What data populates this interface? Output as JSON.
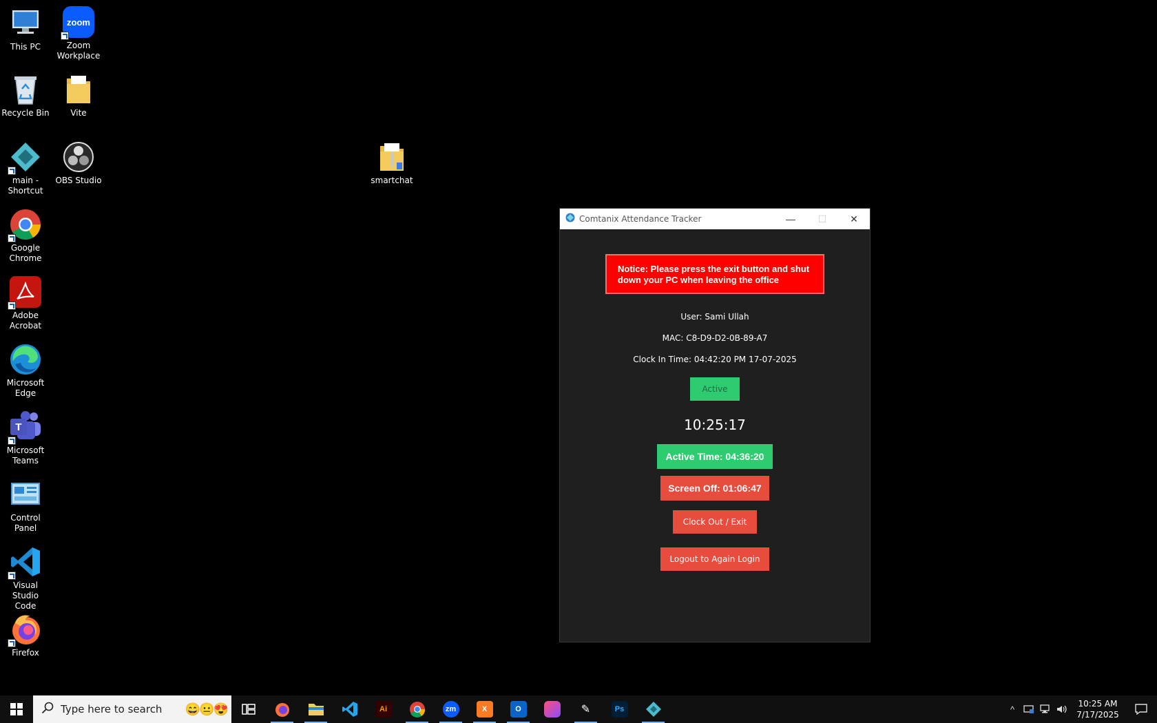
{
  "desktop": {
    "icons": [
      {
        "label": "This PC",
        "icon": "this-pc-icon"
      },
      {
        "label": "Zoom\nWorkplace",
        "icon": "zoom-icon",
        "glyph_text": "zoom"
      },
      {
        "label": "Recycle Bin",
        "icon": "recycle-bin-icon"
      },
      {
        "label": "Vite",
        "icon": "folder-icon"
      },
      {
        "label": "main -\nShortcut",
        "icon": "app-shortcut-icon"
      },
      {
        "label": "OBS Studio",
        "icon": "obs-icon"
      },
      {
        "label": "smartchat",
        "icon": "zip-folder-icon"
      },
      {
        "label": "Google\nChrome",
        "icon": "chrome-icon"
      },
      {
        "label": "Adobe\nAcrobat",
        "icon": "acrobat-icon"
      },
      {
        "label": "Microsoft\nEdge",
        "icon": "edge-icon"
      },
      {
        "label": "Microsoft\nTeams",
        "icon": "teams-icon",
        "glyph_text": "T"
      },
      {
        "label": "Control Panel",
        "icon": "control-panel-icon"
      },
      {
        "label": "Visual Studio\nCode",
        "icon": "vscode-icon"
      },
      {
        "label": "Firefox",
        "icon": "firefox-icon"
      }
    ]
  },
  "window": {
    "title": "Comtanix Attendance Tracker",
    "minimize": "—",
    "maximize": "☐",
    "close": "✕"
  },
  "app": {
    "notice": "Notice: Please press the exit button and shut down your PC when leaving the office",
    "user": "User: Sami Ullah",
    "mac": "MAC: C8-D9-D2-0B-89-A7",
    "clock_in": "Clock In Time: 04:42:20 PM 17-07-2025",
    "status": "Active",
    "current_time": "10:25:17",
    "active_time": "Active Time: 04:36:20",
    "screen_off": "Screen Off: 01:06:47",
    "clock_out_label": "Clock Out / Exit",
    "logout_label": "Logout to Again Login"
  },
  "taskbar": {
    "search_placeholder": "Type here to search",
    "search_emojis": "😄😐😍",
    "pinned": [
      {
        "name": "task-view",
        "text": ""
      },
      {
        "name": "firefox",
        "text": ""
      },
      {
        "name": "file-explorer",
        "text": ""
      },
      {
        "name": "vscode",
        "text": ""
      },
      {
        "name": "illustrator",
        "text": "Ai"
      },
      {
        "name": "chrome",
        "text": ""
      },
      {
        "name": "zoom",
        "text": "zm"
      },
      {
        "name": "xampp",
        "text": "X"
      },
      {
        "name": "outlook",
        "text": "O"
      },
      {
        "name": "creative-cloud",
        "text": ""
      },
      {
        "name": "pen-tool",
        "text": "✎"
      },
      {
        "name": "photoshop",
        "text": "Ps"
      },
      {
        "name": "comtanix",
        "text": ""
      }
    ],
    "tray_chevron": "^",
    "time": "10:25 AM",
    "date": "7/17/2025"
  },
  "colors": {
    "notice_bg": "#ff0000",
    "active_green": "#2ecc71",
    "danger_red": "#e74c3c",
    "window_bg": "#1f1f1f"
  }
}
